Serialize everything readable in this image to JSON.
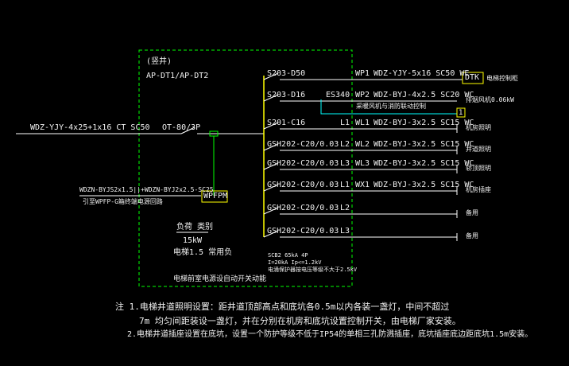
{
  "colors": {
    "background": "#000000",
    "wire": "#ffffff",
    "bus": "#ffff00",
    "panel_green": "#00ff00",
    "device": "#ffff00",
    "link_cyan": "#00ffff",
    "text_main": "#f2f2f2"
  },
  "panel": {
    "location": "(竖井)",
    "name": "AP-DT1/AP-DT2",
    "note": "电梯前室电源设自动开关动能"
  },
  "feeder": {
    "cable": "WDZ-YJY-4x25+1x16 CT SC50",
    "main_switch": "OT-80/3P"
  },
  "fire_monitor": {
    "cable": "WDZN-BYJS2x1.5||+WDZN-BYJ2x2.5-SC25",
    "note": "引至WPFP-G箱终端电源回路",
    "device": "WPFPM"
  },
  "load": {
    "label": "负荷 类别",
    "power": "15kW",
    "level": "电梯1.5 常用负"
  },
  "circuits": [
    {
      "breaker": "S203-D50",
      "circuit": "WP1",
      "cable": "WDZ-YJY-5x16  SC50 WE",
      "load": "电梯控制柜"
    },
    {
      "breaker": "S203-D16",
      "switch": "ES340",
      "circuit": "WP2",
      "cable": "WDZ-BYJ-4x2.5  SC20 WC",
      "load": "排烟风机0.06kW",
      "sub_load": "采暖风机与消防联动控制"
    },
    {
      "breaker": "S201-C16",
      "circuit": "WL1",
      "phase": "L1",
      "cable": "WDZ-BYJ-3x2.5  SC15 WC",
      "load": "机房照明"
    },
    {
      "breaker": "GSH202-C20/0.03",
      "circuit": "WL2",
      "phase": "L2",
      "cable": "WDZ-BYJ-3x2.5  SC15 WC",
      "load": "井道照明"
    },
    {
      "breaker": "GSH202-C20/0.03",
      "circuit": "WL3",
      "phase": "L3",
      "cable": "WDZ-BYJ-3x2.5  SC15 WC",
      "load": "轿顶照明"
    },
    {
      "breaker": "GSH202-C20/0.03",
      "circuit": "WX1",
      "phase": "L1",
      "cable": "WDZ-BYJ-3x2.5  SC15 WC",
      "load": "机房插座"
    },
    {
      "breaker": "GSH202-C20/0.03",
      "phase": "L2",
      "load": "备用"
    },
    {
      "breaker": "GSH202-C20/0.03",
      "phase": "L3",
      "load": "备用"
    }
  ],
  "spd": {
    "model": "SCB2 65kA 4P",
    "line1": "I=20kA Ip<=1.2kV",
    "line2": "电涌保护器按电压等级不大于2.5kV"
  },
  "dtk": {
    "label": "DTK"
  },
  "ann": {
    "label": "1"
  },
  "notes": [
    "注 1.电梯井道照明设置：距井道顶部高点和底坑各0.5m以内各装一盏灯，中间不超过",
    "7m 均匀间距装设一盏灯，并在分别在机房和底坑设置控制开关，由电梯厂家安装。",
    "2.电梯井道插座设置在底坑，设置一个防护等级不低于IP54的单相三孔防溅插座，底坑插座底边距底坑1.5m安装。"
  ]
}
